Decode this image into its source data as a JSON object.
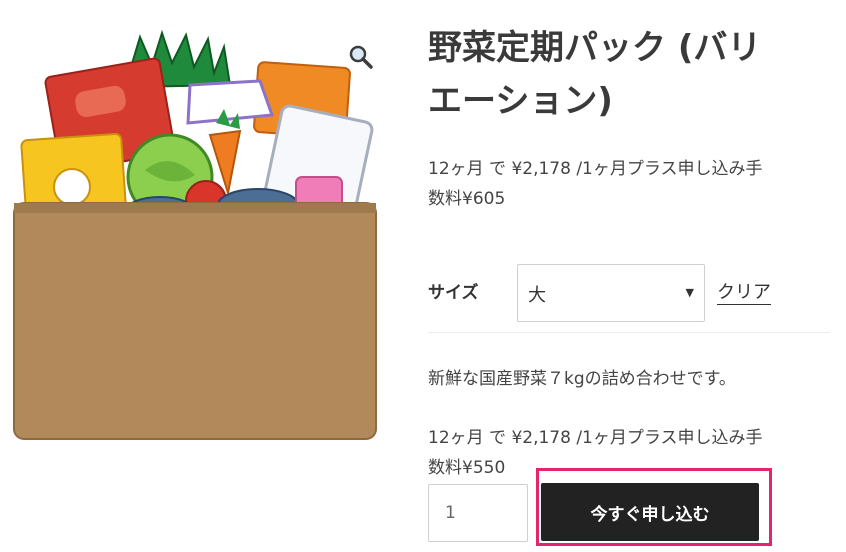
{
  "product": {
    "title_line1": "野菜定期パック (バリ",
    "title_line2": "エーション)",
    "price_summary_line1": "12ヶ月 で ¥2,178 /1ヶ月プラス申し込み手",
    "price_summary_line2": "数料¥605",
    "image_icon": "vegetable-box-illustration",
    "zoom_icon": "magnifier-icon"
  },
  "variation": {
    "label": "サイズ",
    "selected": "大",
    "clear_label": "クリア"
  },
  "selected_variation": {
    "description": "新鮮な国産野菜７kgの詰め合わせです。",
    "price_line1": "12ヶ月 で ¥2,178 /1ヶ月プラス申し込み手",
    "price_line2": "数料¥550"
  },
  "cart": {
    "quantity": "1",
    "button_label": "今すぐ申し込む"
  },
  "colors": {
    "highlight": "#e2256f",
    "button_bg": "#222222",
    "box": "#b1895a"
  }
}
